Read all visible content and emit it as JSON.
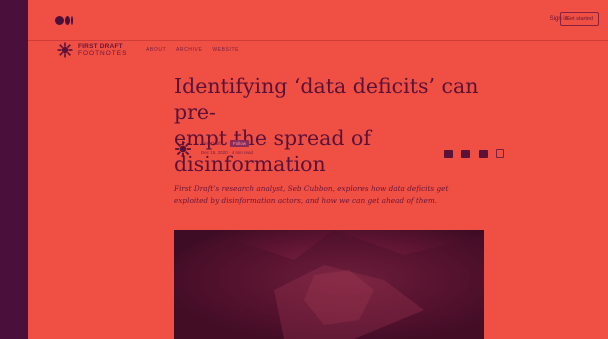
{
  "topbar": {
    "logo": "medium-logo",
    "signin": "Sign in",
    "get_started": "Get started"
  },
  "publication": {
    "name_line1": "FIRST DRAFT",
    "name_line2": "FOOTNOTES",
    "nav": [
      "ABOUT",
      "ARCHIVE",
      "WEBSITE"
    ],
    "icon": "sunburst-icon"
  },
  "article": {
    "title_line1": "Identifying ‘data deficits’ can pre-",
    "title_line2": "empt the spread of disinformation",
    "author": "First Draft",
    "follow": "Follow",
    "date": "Dec 15, 2020 · 4 min read",
    "lede_line1": "First Draft’s research analyst, Seb Cubbon, explores how data deficits get",
    "lede_line2": "exploited by disinformation actors, and how we can get ahead of them.",
    "share_icons": [
      "twitter-icon",
      "linkedin-icon",
      "facebook-icon",
      "bookmark-icon"
    ]
  },
  "colors": {
    "background": "#4a0f3a",
    "page": "#f04f43",
    "text": "#5a1238"
  }
}
